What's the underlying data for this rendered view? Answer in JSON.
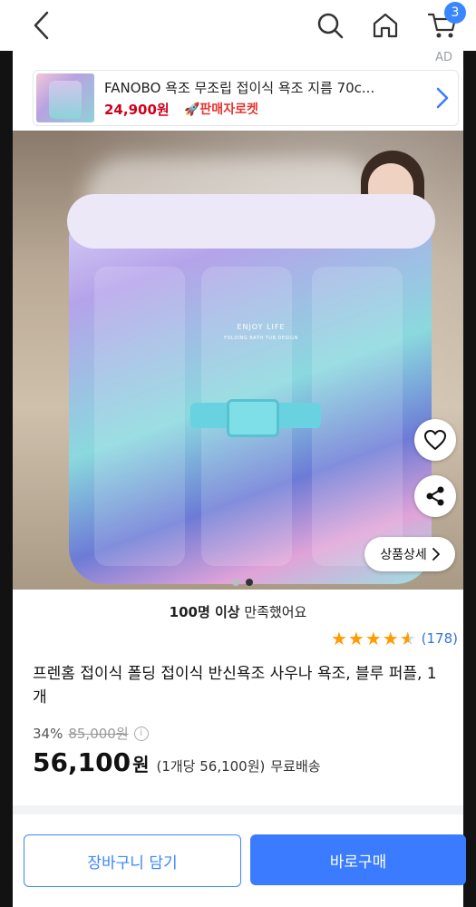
{
  "header": {
    "cart_count": "3",
    "ad_label": "AD",
    "icons": [
      "back-icon",
      "search-icon",
      "home-icon",
      "cart-icon"
    ]
  },
  "ad_banner": {
    "title": "FANOBO 욕조 무조립 접이식 욕조 지름 70c...",
    "price": "24,900원",
    "delivery": "🚀판매자로켓"
  },
  "hero": {
    "enjoy_text": "ENJOY LIFE",
    "enjoy_sub": "FOLDING BATH TUB DESIGN",
    "detail_button": "상품상세",
    "slide_count": 2,
    "active_slide": 2
  },
  "product": {
    "satisfied_count": "100명 이상",
    "satisfied_text": " 만족했어요",
    "rating": 4.5,
    "review_count": "(178)",
    "title": "프렌홈 접이식 폴딩 접이식 반신욕조 사우나 욕조, 블루 퍼플, 1개",
    "discount_rate": "34%",
    "original_price": "85,000원",
    "price": "56,100",
    "price_unit": "원",
    "unit_price": "(1개당 56,100원)",
    "shipping": "무료배송"
  },
  "actions": {
    "add_to_cart": "장바구니 담기",
    "buy_now": "바로구매"
  },
  "colors": {
    "accent": "#3a7bff",
    "star": "#ff9b00",
    "sale_red": "#d0021b"
  }
}
